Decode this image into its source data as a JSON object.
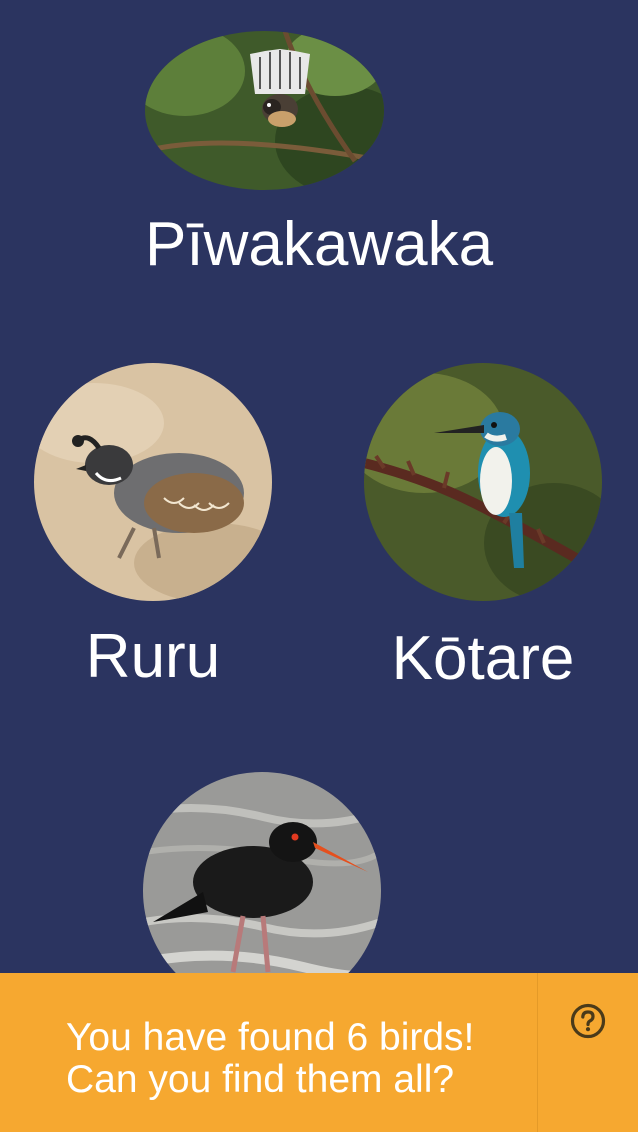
{
  "birds": [
    {
      "name": "Pīwakawaka",
      "photo": "fantail-photo"
    },
    {
      "name": "Ruru",
      "photo": "quail-photo"
    },
    {
      "name": "Kōtare",
      "photo": "kingfisher-photo"
    },
    {
      "name": "",
      "photo": "oystercatcher-photo"
    }
  ],
  "footer": {
    "line1": "You have found 6 birds!",
    "line2": "Can you find them all?",
    "help_icon": "question-circle-icon"
  },
  "colors": {
    "background": "#2b3460",
    "footer": "#f6a830",
    "text": "#ffffff"
  }
}
